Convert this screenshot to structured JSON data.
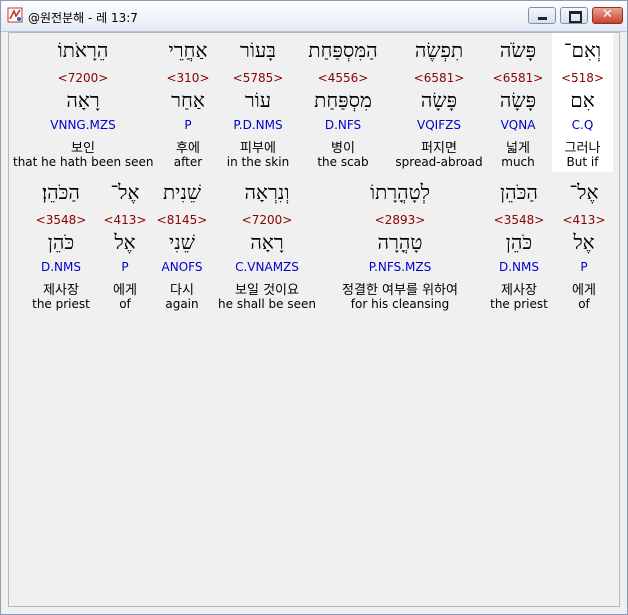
{
  "window": {
    "title": "@원전분해 - 레 13:7"
  },
  "row1": [
    {
      "heb": "וְאִם־",
      "strong": "<518>",
      "root": "אִם",
      "morph": "C.Q",
      "kor": "그러나",
      "eng": "But if"
    },
    {
      "heb": "פָּשֹׂה",
      "strong": "<6581>",
      "root": "פָּשָׂה",
      "morph": "VQNA",
      "kor": "넓게",
      "eng": "much"
    },
    {
      "heb": "תִפְשֶׂה",
      "strong": "<6581>",
      "root": "פָּשָׂה",
      "morph": "VQIFZS",
      "kor": "퍼지면",
      "eng": "spread-abroad"
    },
    {
      "heb": "הַמִּסְפַּחַת",
      "strong": "<4556>",
      "root": "מִסְפַּחַת",
      "morph": "D.NFS",
      "kor": "병이",
      "eng": "the scab"
    },
    {
      "heb": "בָּעוֹר",
      "strong": "<5785>",
      "root": "עוֹר",
      "morph": "P.D.NMS",
      "kor": "피부에",
      "eng": "in the skin"
    },
    {
      "heb": "אַחֲרֵי",
      "strong": "<310>",
      "root": "אַחַר",
      "morph": "P",
      "kor": "후에",
      "eng": "after"
    },
    {
      "heb": "הֵרָאֹתוֹ",
      "strong": "<7200>",
      "root": "רָאָה",
      "morph": "VNNG.MZS",
      "kor": "보인",
      "eng": "that he hath been seen"
    }
  ],
  "row2": [
    {
      "heb": "אֶל־",
      "strong": "<413>",
      "root": "אֶל",
      "morph": "P",
      "kor": "에게",
      "eng": "of"
    },
    {
      "heb": "הַכֹּהֵן",
      "strong": "<3548>",
      "root": "כֹּהֵן",
      "morph": "D.NMS",
      "kor": "제사장",
      "eng": "the priest"
    },
    {
      "heb": "לְטָהֳרָתוֹ",
      "strong": "<2893>",
      "root": "טָהֳרָה",
      "morph": "P.NFS.MZS",
      "kor": "정결한 여부를 위하여",
      "eng": "for his cleansing"
    },
    {
      "heb": "וְנִרְאָה",
      "strong": "<7200>",
      "root": "רָאָה",
      "morph": "C.VNAMZS",
      "kor": "보일 것이요",
      "eng": "he shall be seen"
    },
    {
      "heb": "שֵׁנִית",
      "strong": "<8145>",
      "root": "שֵׁנִי",
      "morph": "ANOFS",
      "kor": "다시",
      "eng": "again"
    },
    {
      "heb": "אֶל־",
      "strong": "<413>",
      "root": "אֶל",
      "morph": "P",
      "kor": "에게",
      "eng": "of"
    },
    {
      "heb": "הַכֹּהֵן׃",
      "strong": "<3548>",
      "root": "כֹּהֵן",
      "morph": "D.NMS",
      "kor": "제사장",
      "eng": "the priest"
    }
  ]
}
